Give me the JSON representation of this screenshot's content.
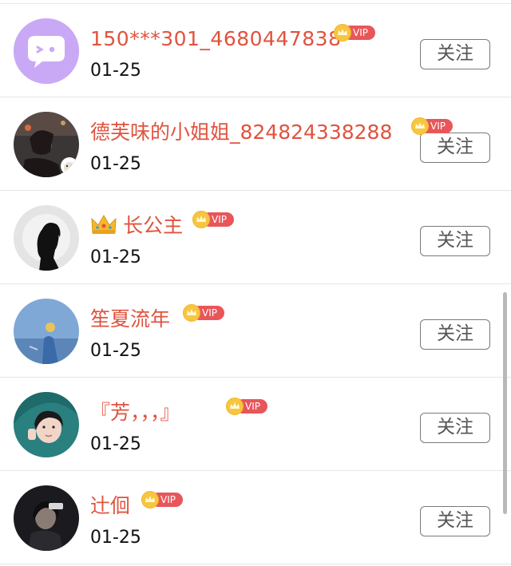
{
  "follow_list": {
    "follow_label": "关注",
    "vip_label": "VIP",
    "items": [
      {
        "name": "150***301_4680447838",
        "date": "01-25",
        "avatar_icon": "chat-bubble-wink-icon",
        "prefix_emoji": ""
      },
      {
        "name": "德芙味的小姐姐_824824338288",
        "date": "01-25",
        "avatar_icon": "photo-avatar",
        "prefix_emoji": ""
      },
      {
        "name": "长公主",
        "date": "01-25",
        "avatar_icon": "silhouette-avatar",
        "prefix_emoji": "crown"
      },
      {
        "name": "笙夏流年",
        "date": "01-25",
        "avatar_icon": "photo-avatar",
        "prefix_emoji": ""
      },
      {
        "name": "『芳，，，』",
        "date": "01-25",
        "avatar_icon": "photo-avatar",
        "prefix_emoji": ""
      },
      {
        "name": "辻佪",
        "date": "01-25",
        "avatar_icon": "photo-avatar",
        "prefix_emoji": ""
      }
    ]
  },
  "colors": {
    "name": "#e0533f",
    "vip_pill": "#e8565a",
    "vip_crown": "#f7c640",
    "default_avatar": "#c9a9f5"
  }
}
